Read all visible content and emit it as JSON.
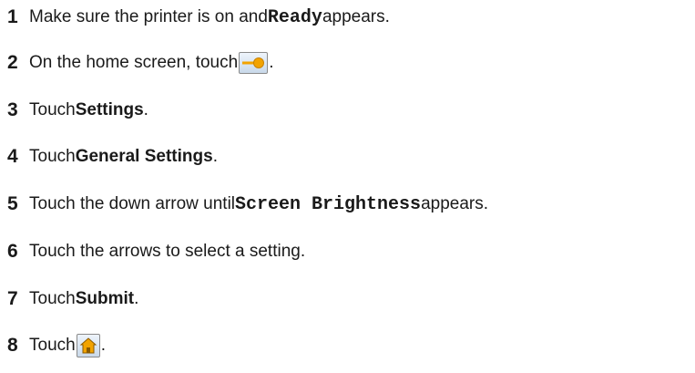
{
  "steps": [
    {
      "number": "1",
      "parts": {
        "a": "Make sure the printer is on and ",
        "b": "Ready",
        "c": " appears."
      }
    },
    {
      "number": "2",
      "parts": {
        "a": "On the home screen, touch ",
        "icon": "settings-key-icon",
        "c": "."
      }
    },
    {
      "number": "3",
      "parts": {
        "a": "Touch ",
        "b": "Settings",
        "c": "."
      }
    },
    {
      "number": "4",
      "parts": {
        "a": "Touch ",
        "b": "General Settings",
        "c": "."
      }
    },
    {
      "number": "5",
      "parts": {
        "a": "Touch the down arrow until ",
        "b": "Screen Brightness",
        "c": " appears."
      }
    },
    {
      "number": "6",
      "parts": {
        "a": "Touch the arrows to select a setting."
      }
    },
    {
      "number": "7",
      "parts": {
        "a": "Touch ",
        "b": "Submit",
        "c": "."
      }
    },
    {
      "number": "8",
      "parts": {
        "a": "Touch ",
        "icon": "home-icon",
        "c": "."
      }
    }
  ],
  "colors": {
    "text": "#1a1a1a",
    "key_icon_fill": "#f2a300",
    "icon_background": "#d6e4f2"
  }
}
